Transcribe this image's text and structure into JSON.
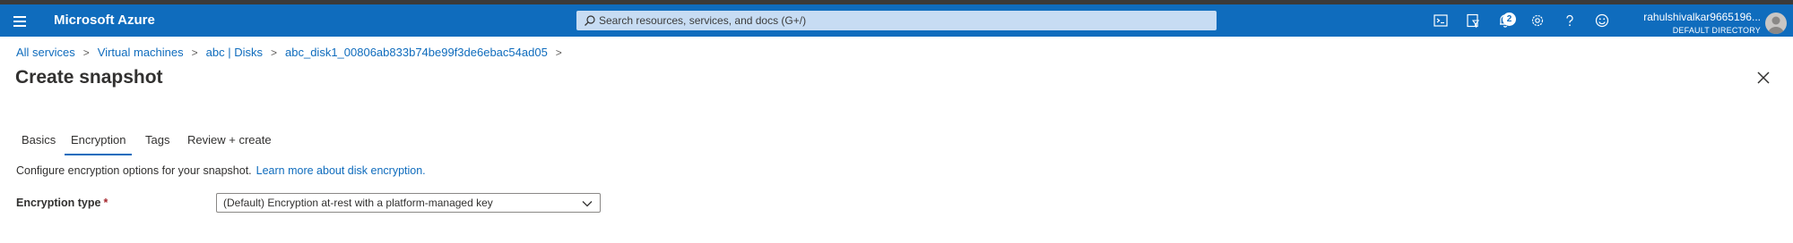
{
  "topbar": {
    "brand": "Microsoft Azure",
    "search_placeholder": "Search resources, services, and docs (G+/)",
    "notification_count": "2",
    "account_name": "rahulshivalkar9665196...",
    "account_directory": "DEFAULT DIRECTORY",
    "icons": [
      "cloud-shell-icon",
      "directory-filter-icon",
      "notifications-icon",
      "settings-icon",
      "help-icon",
      "feedback-icon"
    ]
  },
  "breadcrumb": [
    "All services",
    "Virtual machines",
    "abc | Disks",
    "abc_disk1_00806ab833b74be99f3de6ebac54ad05"
  ],
  "page": {
    "title": "Create snapshot"
  },
  "tabs": [
    "Basics",
    "Encryption",
    "Tags",
    "Review + create"
  ],
  "active_tab": "Encryption",
  "content": {
    "description": "Configure encryption options for your snapshot.",
    "learn_more": "Learn more about disk encryption.",
    "encryption_type_label": "Encryption type",
    "required_marker": "*",
    "encryption_type_value": "(Default) Encryption at-rest with a platform-managed key"
  },
  "colors": {
    "topbar": "#0f6cbd",
    "link": "#0f6cbd",
    "required": "#a4262c"
  }
}
